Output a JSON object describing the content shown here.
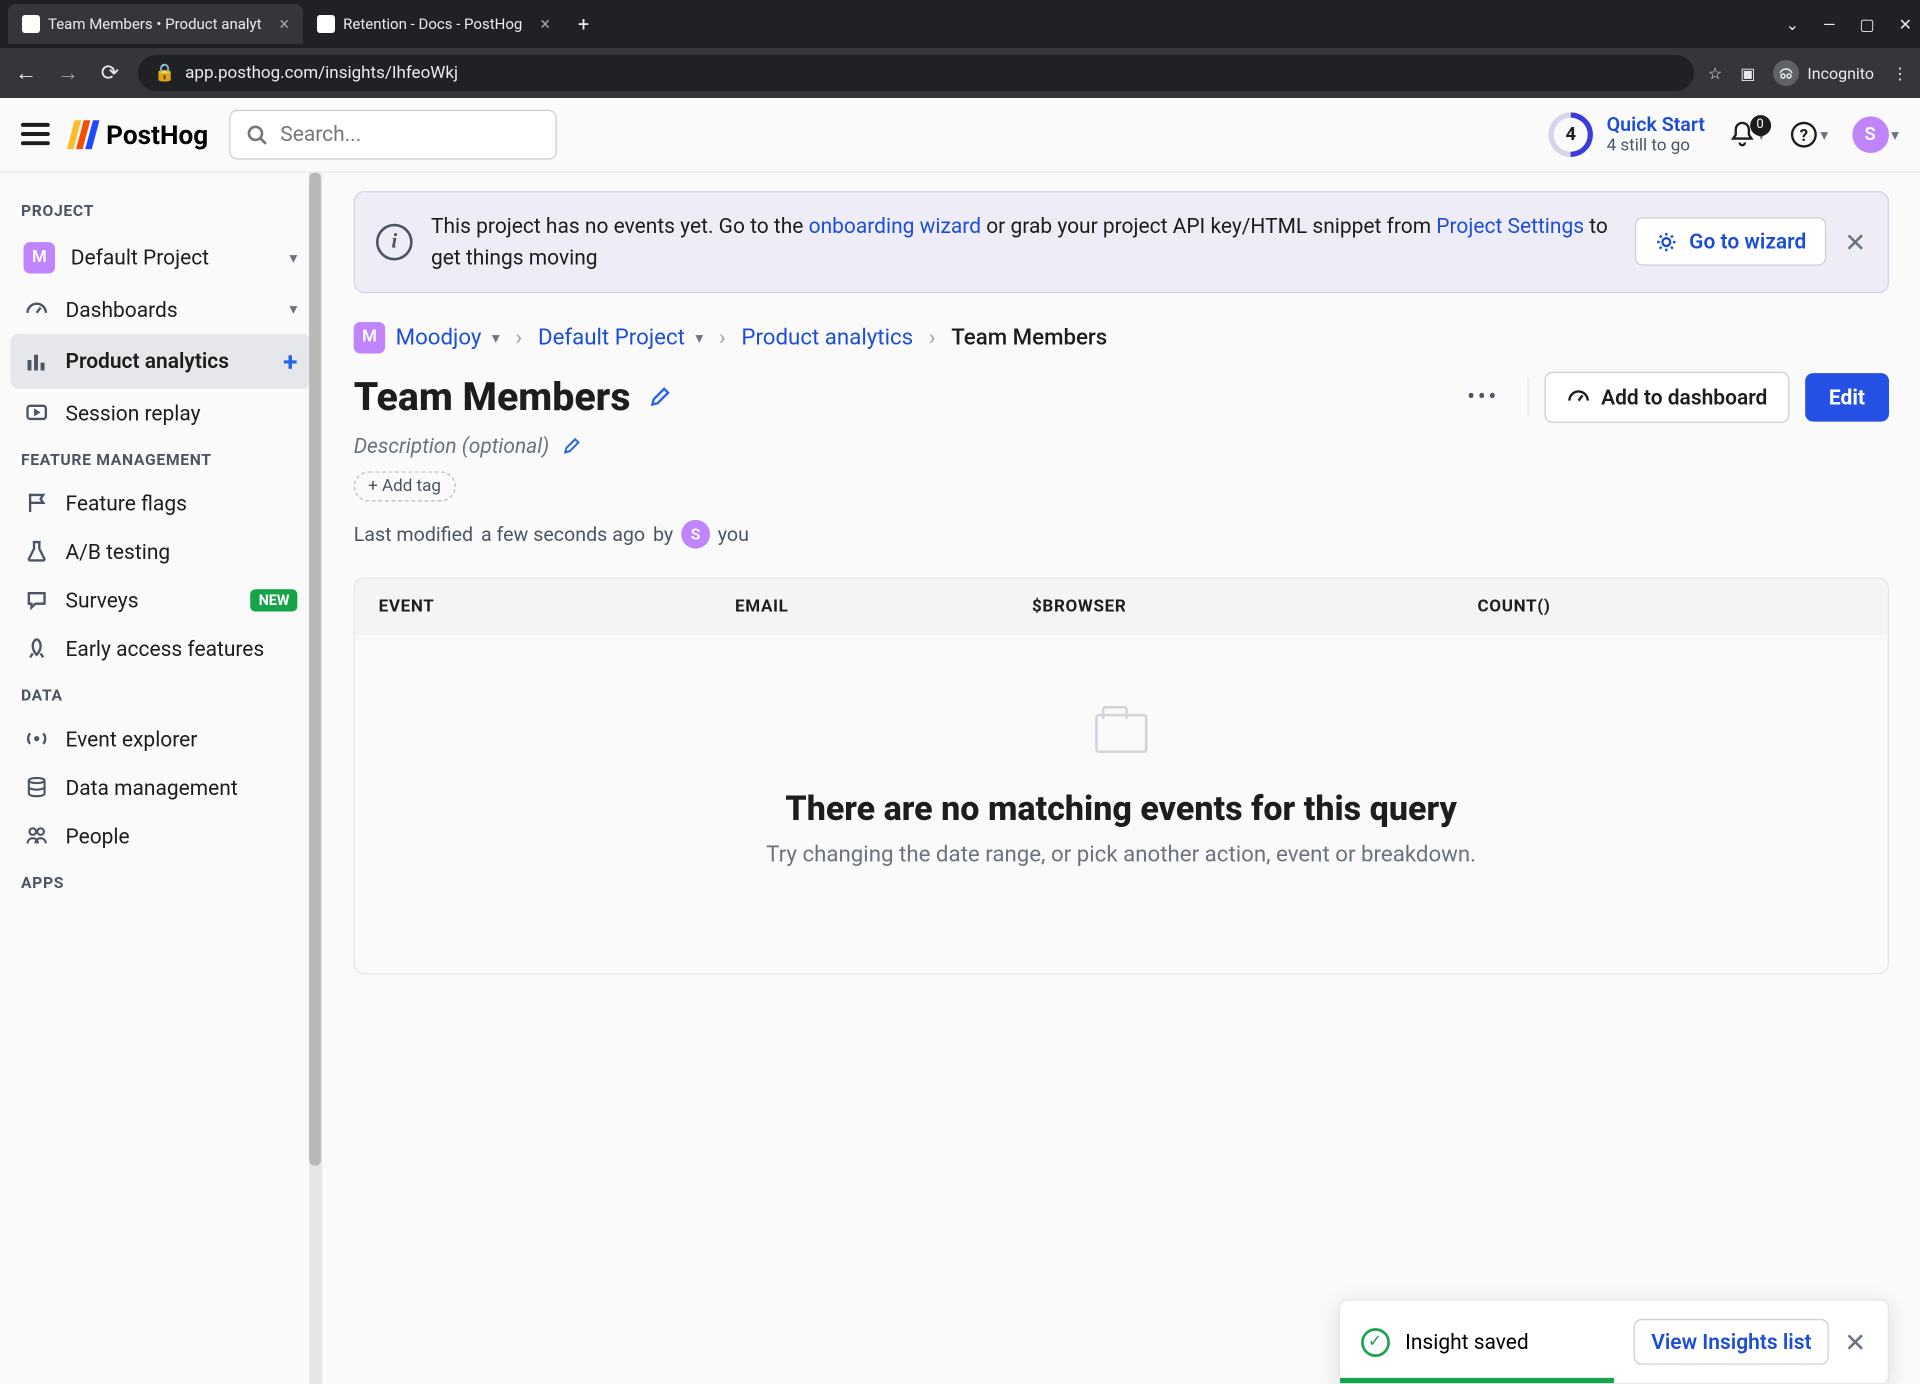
{
  "browser": {
    "tabs": [
      {
        "title": "Team Members • Product analyt",
        "active": true
      },
      {
        "title": "Retention - Docs - PostHog",
        "active": false
      }
    ],
    "url": "app.posthog.com/insights/IhfeoWkj",
    "incognito": "Incognito"
  },
  "topbar": {
    "logo": "PostHog",
    "search_placeholder": "Search...",
    "quickstart": {
      "title": "Quick Start",
      "subtitle": "4 still to go",
      "count": "4"
    },
    "notif_count": "0",
    "user_letter": "S"
  },
  "sidebar": {
    "sections": {
      "project": "PROJECT",
      "feature": "FEATURE MANAGEMENT",
      "data": "DATA",
      "apps": "APPS"
    },
    "project_item": {
      "letter": "M",
      "label": "Default Project"
    },
    "dashboards": "Dashboards",
    "product_analytics": "Product analytics",
    "session_replay": "Session replay",
    "feature_flags": "Feature flags",
    "ab_testing": "A/B testing",
    "surveys": "Surveys",
    "surveys_badge": "NEW",
    "early_access": "Early access features",
    "event_explorer": "Event explorer",
    "data_management": "Data management",
    "people": "People"
  },
  "banner": {
    "text_pre": "This project has no events yet. Go to the ",
    "link1": "onboarding wizard",
    "text_mid": " or grab your project API key/HTML snippet from ",
    "link2": "Project Settings",
    "text_post": " to get things moving",
    "button": "Go to wizard"
  },
  "breadcrumbs": {
    "org_letter": "M",
    "org": "Moodjoy",
    "project": "Default Project",
    "section": "Product analytics",
    "current": "Team Members"
  },
  "page": {
    "title": "Team Members",
    "description_placeholder": "Description (optional)",
    "add_tag": "+ Add tag",
    "modified_pre": "Last modified",
    "modified_time": "a few seconds ago",
    "modified_by": "by",
    "modified_user_letter": "S",
    "modified_user": "you",
    "actions": {
      "add_dashboard": "Add to dashboard",
      "edit": "Edit"
    }
  },
  "table": {
    "cols": {
      "event": "EVENT",
      "email": "EMAIL",
      "browser": "$BROWSER",
      "count": "COUNT()"
    },
    "empty_title": "There are no matching events for this query",
    "empty_sub": "Try changing the date range, or pick another action, event or breakdown."
  },
  "toast": {
    "msg": "Insight saved",
    "link": "View Insights list"
  }
}
